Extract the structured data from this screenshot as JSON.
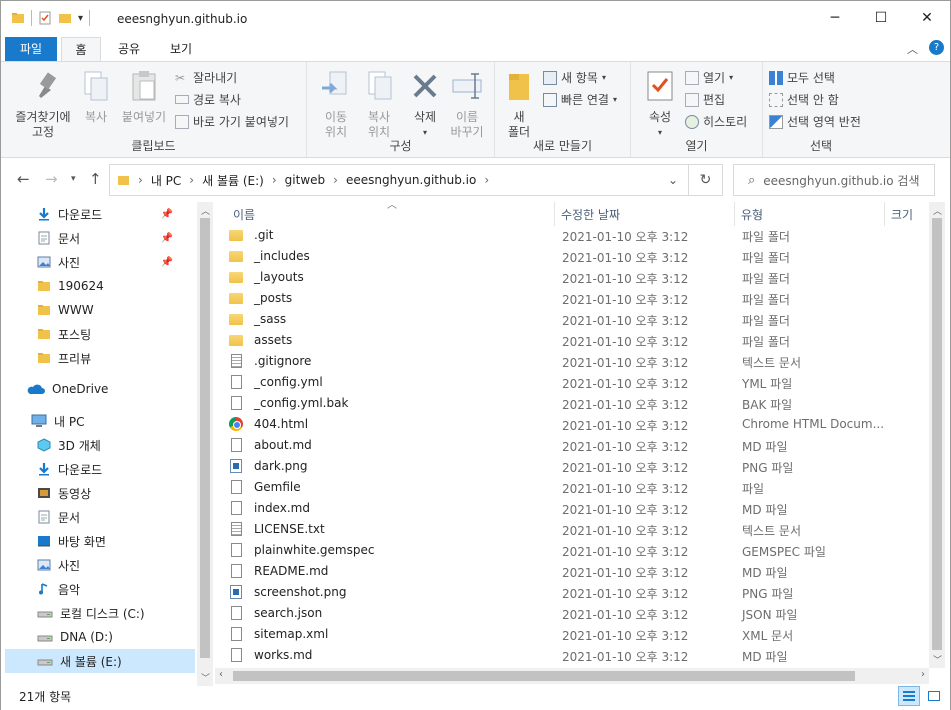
{
  "window": {
    "title": "eeesnghyun.github.io",
    "minimize": "─",
    "maximize": "☐",
    "close": "✕"
  },
  "tabs": {
    "file": "파일",
    "home": "홈",
    "share": "공유",
    "view": "보기"
  },
  "ribbon": {
    "clipboard": {
      "pin": "즐겨찾기에\n고정",
      "pin_l1": "즐겨찾기에",
      "pin_l2": "고정",
      "copy": "복사",
      "paste": "붙여넣기",
      "cut": "잘라내기",
      "copy_path": "경로 복사",
      "paste_shortcut": "바로 가기 붙여넣기",
      "label": "클립보드"
    },
    "organize": {
      "move_l1": "이동",
      "move_l2": "위치",
      "copyto_l1": "복사",
      "copyto_l2": "위치",
      "delete": "삭제",
      "rename_l1": "이름",
      "rename_l2": "바꾸기",
      "label": "구성"
    },
    "new": {
      "folder_l1": "새",
      "folder_l2": "폴더",
      "new_item": "새 항목",
      "easy_access": "빠른 연결",
      "label": "새로 만들기"
    },
    "open": {
      "properties": "속성",
      "open": "열기",
      "edit": "편집",
      "history": "히스토리",
      "label": "열기"
    },
    "select": {
      "select_all": "모두 선택",
      "select_none": "선택 안 함",
      "invert": "선택 영역 반전",
      "label": "선택"
    }
  },
  "address": {
    "crumbs": [
      "내 PC",
      "새 볼륨 (E:)",
      "gitweb",
      "eeesnghyun.github.io"
    ],
    "search_placeholder": "eeesnghyun.github.io 검색"
  },
  "nav": {
    "quick": [
      {
        "label": "다운로드",
        "icon": "download-icon",
        "pinned": true
      },
      {
        "label": "문서",
        "icon": "document-icon",
        "pinned": true
      },
      {
        "label": "사진",
        "icon": "pictures-icon",
        "pinned": true
      },
      {
        "label": "190624",
        "icon": "folder-icon",
        "pinned": false
      },
      {
        "label": "WWW",
        "icon": "folder-icon",
        "pinned": false
      },
      {
        "label": "포스팅",
        "icon": "folder-icon",
        "pinned": false
      },
      {
        "label": "프리뷰",
        "icon": "folder-icon",
        "pinned": false
      }
    ],
    "onedrive": "OneDrive",
    "thispc": "내 PC",
    "pc_items": [
      {
        "label": "3D 개체",
        "icon": "3d-objects-icon"
      },
      {
        "label": "다운로드",
        "icon": "download-icon"
      },
      {
        "label": "동영상",
        "icon": "video-icon"
      },
      {
        "label": "문서",
        "icon": "document-icon"
      },
      {
        "label": "바탕 화면",
        "icon": "desktop-icon"
      },
      {
        "label": "사진",
        "icon": "pictures-icon"
      },
      {
        "label": "음악",
        "icon": "music-icon"
      },
      {
        "label": "로컬 디스크 (C:)",
        "icon": "drive-icon"
      },
      {
        "label": "DNA (D:)",
        "icon": "drive-icon"
      },
      {
        "label": "새 볼륨 (E:)",
        "icon": "drive-icon"
      }
    ]
  },
  "columns": {
    "name": "이름",
    "date": "수정한 날짜",
    "type": "유형",
    "size": "크기"
  },
  "files": [
    {
      "name": ".git",
      "date": "2021-01-10 오후 3:12",
      "type": "파일 폴더",
      "icon": "folder"
    },
    {
      "name": "_includes",
      "date": "2021-01-10 오후 3:12",
      "type": "파일 폴더",
      "icon": "folder"
    },
    {
      "name": "_layouts",
      "date": "2021-01-10 오후 3:12",
      "type": "파일 폴더",
      "icon": "folder"
    },
    {
      "name": "_posts",
      "date": "2021-01-10 오후 3:12",
      "type": "파일 폴더",
      "icon": "folder"
    },
    {
      "name": "_sass",
      "date": "2021-01-10 오후 3:12",
      "type": "파일 폴더",
      "icon": "folder"
    },
    {
      "name": "assets",
      "date": "2021-01-10 오후 3:12",
      "type": "파일 폴더",
      "icon": "folder"
    },
    {
      "name": ".gitignore",
      "date": "2021-01-10 오후 3:12",
      "type": "텍스트 문서",
      "icon": "docl"
    },
    {
      "name": "_config.yml",
      "date": "2021-01-10 오후 3:12",
      "type": "YML 파일",
      "icon": "doc"
    },
    {
      "name": "_config.yml.bak",
      "date": "2021-01-10 오후 3:12",
      "type": "BAK 파일",
      "icon": "doc"
    },
    {
      "name": "404.html",
      "date": "2021-01-10 오후 3:12",
      "type": "Chrome HTML Docum...",
      "icon": "chrome"
    },
    {
      "name": "about.md",
      "date": "2021-01-10 오후 3:12",
      "type": "MD 파일",
      "icon": "doc"
    },
    {
      "name": "dark.png",
      "date": "2021-01-10 오후 3:12",
      "type": "PNG 파일",
      "icon": "img"
    },
    {
      "name": "Gemfile",
      "date": "2021-01-10 오후 3:12",
      "type": "파일",
      "icon": "doc"
    },
    {
      "name": "index.md",
      "date": "2021-01-10 오후 3:12",
      "type": "MD 파일",
      "icon": "doc"
    },
    {
      "name": "LICENSE.txt",
      "date": "2021-01-10 오후 3:12",
      "type": "텍스트 문서",
      "icon": "docl"
    },
    {
      "name": "plainwhite.gemspec",
      "date": "2021-01-10 오후 3:12",
      "type": "GEMSPEC 파일",
      "icon": "doc"
    },
    {
      "name": "README.md",
      "date": "2021-01-10 오후 3:12",
      "type": "MD 파일",
      "icon": "doc"
    },
    {
      "name": "screenshot.png",
      "date": "2021-01-10 오후 3:12",
      "type": "PNG 파일",
      "icon": "img"
    },
    {
      "name": "search.json",
      "date": "2021-01-10 오후 3:12",
      "type": "JSON 파일",
      "icon": "doc"
    },
    {
      "name": "sitemap.xml",
      "date": "2021-01-10 오후 3:12",
      "type": "XML 문서",
      "icon": "doc"
    },
    {
      "name": "works.md",
      "date": "2021-01-10 오후 3:12",
      "type": "MD 파일",
      "icon": "doc"
    }
  ],
  "status": {
    "count": "21개 항목"
  },
  "colors": {
    "accent": "#1979ca",
    "selection": "#cce8ff",
    "folder": "#f0c24a"
  }
}
